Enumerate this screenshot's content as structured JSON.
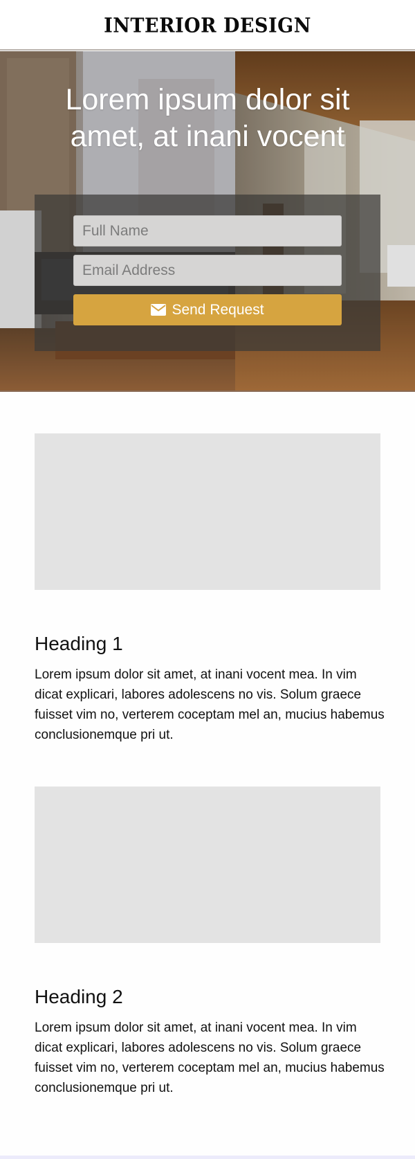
{
  "header": {
    "logo_text": "INTERIOR DESIGN"
  },
  "hero": {
    "title": "Lorem ipsum dolor sit amet, at inani vocent",
    "form": {
      "name_placeholder": "Full Name",
      "email_placeholder": "Email Address",
      "submit_label": "Send Request",
      "submit_icon": "envelope-icon"
    }
  },
  "sections": [
    {
      "heading": "Heading 1",
      "body": "Lorem ipsum dolor sit amet, at inani vocent mea. In vim dicat explicari, labores adolescens no vis. Solum graece fuisset vim no, verterem coceptam mel an, mucius habemus conclusionemque pri ut."
    },
    {
      "heading": "Heading 2",
      "body": "Lorem ipsum dolor sit amet, at inani vocent mea. In vim dicat explicari, labores adolescens no vis. Solum graece fuisset vim no, verterem coceptam mel an, mucius habemus conclusionemque pri ut."
    }
  ],
  "colors": {
    "accent": "#d6a440",
    "image_placeholder": "#e3e3e3",
    "form_overlay": "#3c3a38"
  }
}
